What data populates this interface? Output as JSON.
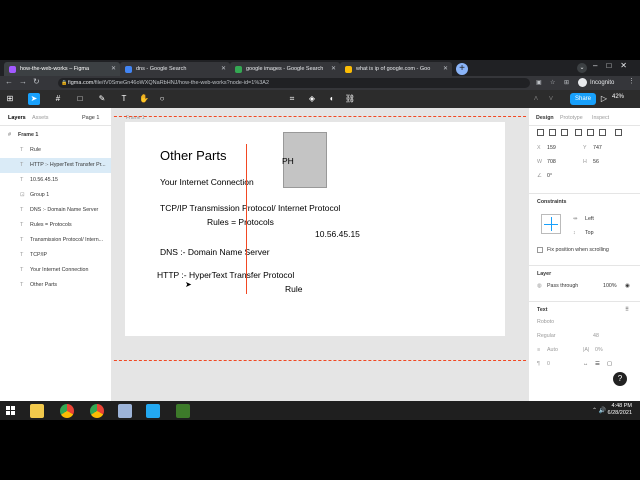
{
  "browser": {
    "tabs": [
      {
        "label": "how-the-web-works – Figma",
        "color": "#a259ff"
      },
      {
        "label": "dns - Google Search",
        "color": "#4285f4"
      },
      {
        "label": "google images - Google Search",
        "color": "#34a853"
      },
      {
        "label": "what is ip of google.com - Goo",
        "color": "#fbbc05"
      }
    ],
    "new_tab": "+",
    "url_host": "figma.com",
    "url_path": "/file/tV0SmeGn46oWXQNaRbHNJ/how-the-web-works?node-id=1%3A2",
    "profile": "Incognito",
    "window_controls": "–□✕"
  },
  "figma": {
    "toolbar_zoom": "42%",
    "share_label": "Share",
    "left_panel": {
      "tab_layers": "Layers",
      "tab_assets": "Assets",
      "page": "Page 1",
      "layers": [
        {
          "name": "Frame 1",
          "type": "frame"
        },
        {
          "name": "Rule",
          "type": "text"
        },
        {
          "name": "HTTP :- HyperText Transfer Pr...",
          "type": "text",
          "selected": true
        },
        {
          "name": "10.56.45.15",
          "type": "text"
        },
        {
          "name": "Group 1",
          "type": "group"
        },
        {
          "name": "DNS :- Domain Name Server",
          "type": "text"
        },
        {
          "name": "Rules = Protocols",
          "type": "text"
        },
        {
          "name": "Transmission Protocol/ Intern...",
          "type": "text"
        },
        {
          "name": "TCP/IP",
          "type": "text"
        },
        {
          "name": "Your Internet Connection",
          "type": "text"
        },
        {
          "name": "Other Parts",
          "type": "text"
        }
      ]
    },
    "canvas": {
      "frame_label": "Frame 1",
      "texts": {
        "title": "Other Parts",
        "connection": "Your Internet Connection",
        "tcpip": "TCP/IP   Transmission Protocol/ Internet Protocol",
        "rules": "Rules = Protocols",
        "ip": "10.56.45.15",
        "dns": "DNS :- Domain Name Server",
        "http": "HTTP :- HyperText Transfer Protocol",
        "rule": "Rule",
        "ph": "PH"
      }
    },
    "right_panel": {
      "tab_design": "Design",
      "tab_prototype": "Prototype",
      "tab_inspect": "Inspect",
      "x_label": "X",
      "x": "159",
      "y_label": "Y",
      "y": "747",
      "w_label": "W",
      "w": "708",
      "h_label": "H",
      "h": "56",
      "rotation": "0°",
      "constraints_title": "Constraints",
      "constraint_h": "Left",
      "constraint_v": "Top",
      "fix_position": "Fix position when scrolling",
      "layer_title": "Layer",
      "blend": "Pass through",
      "opacity": "100%",
      "text_title": "Text",
      "font": "Roboto",
      "weight": "Regular",
      "size": "48",
      "line_height": "Auto",
      "letter_spacing": "0%",
      "para": "0"
    }
  },
  "taskbar": {
    "time": "4:48 PM",
    "date": "6/28/2021"
  },
  "colors": {
    "figma_blue": "#18a0fb",
    "guide_red": "#f24822"
  }
}
